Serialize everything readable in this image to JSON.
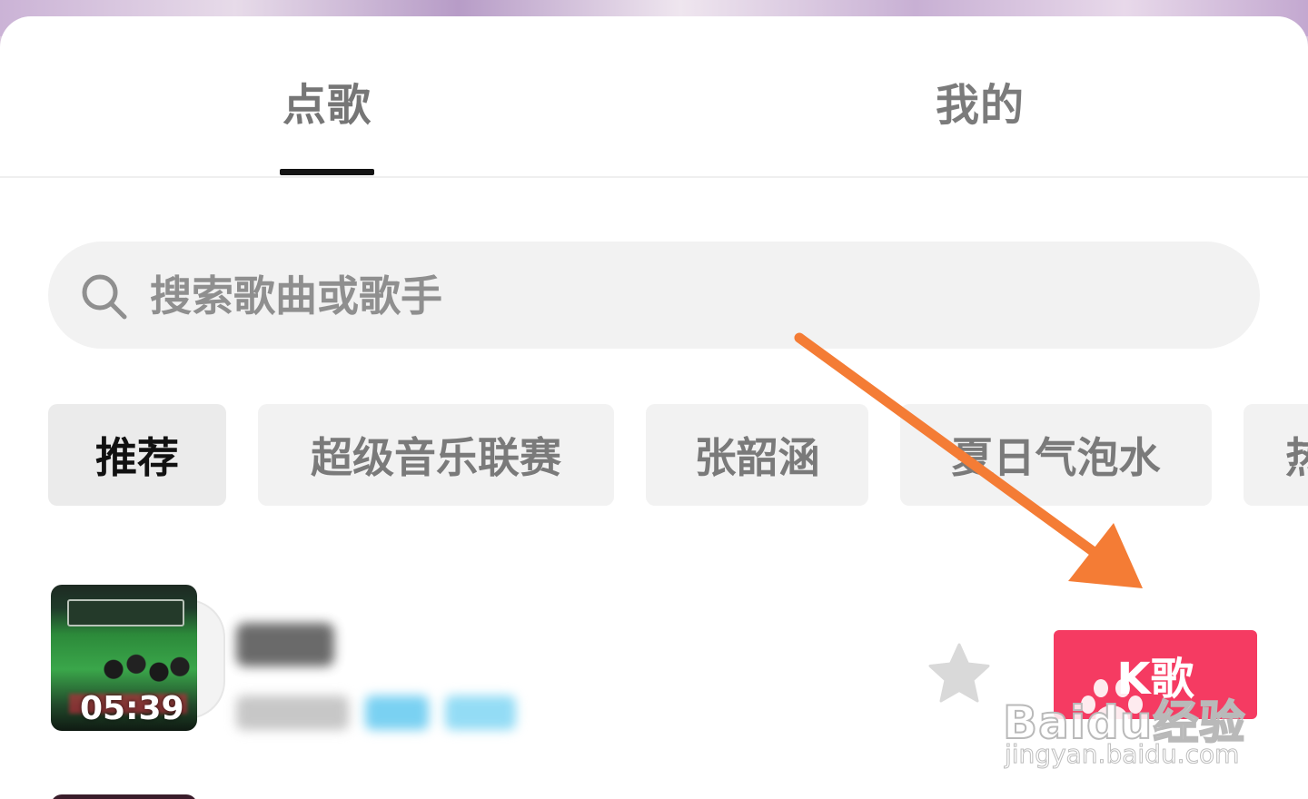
{
  "tabs": [
    {
      "label": "点歌",
      "active": true
    },
    {
      "label": "我的",
      "active": false
    }
  ],
  "search": {
    "placeholder": "搜索歌曲或歌手",
    "value": ""
  },
  "chips": [
    {
      "label": "推荐",
      "selected": true
    },
    {
      "label": "超级音乐联赛",
      "selected": false
    },
    {
      "label": "张韶涵",
      "selected": false
    },
    {
      "label": "夏日气泡水",
      "selected": false
    },
    {
      "label": "热",
      "selected": false
    }
  ],
  "song": {
    "duration": "05:39",
    "k_button_label": "K歌",
    "favorite_icon": "star-icon",
    "accent_color": "#f53b62"
  },
  "icons": {
    "search": "search-icon",
    "favorite": "star-icon",
    "annotation": "arrow-icon"
  },
  "watermark": {
    "main": "Baidu经验",
    "sub": "jingyan.baidu.com"
  }
}
